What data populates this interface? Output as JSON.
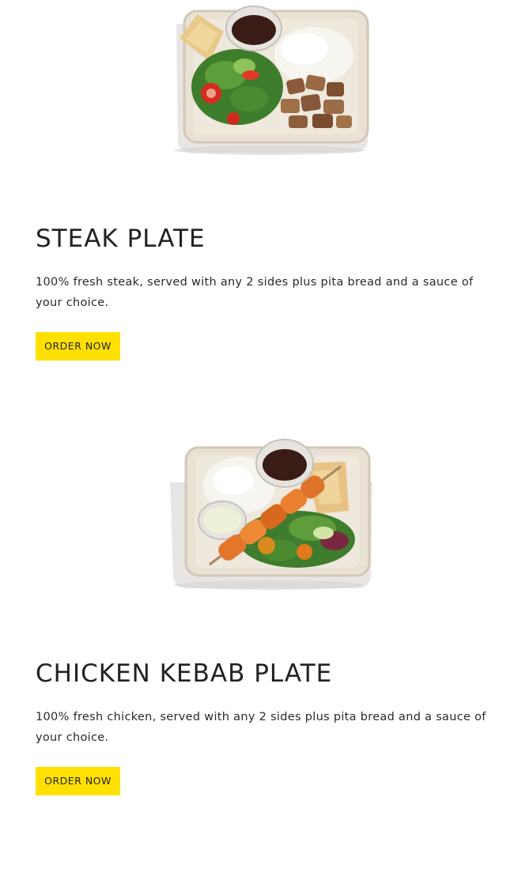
{
  "menu_items": [
    {
      "title": "STEAK PLATE",
      "description": "100% fresh steak, served with any 2 sides plus pita bread and a sauce of your choice.",
      "button_label": "ORDER NOW",
      "image_icon": "steak-plate-image"
    },
    {
      "title": "CHICKEN KEBAB PLATE",
      "description": "100% fresh chicken, served with any 2 sides plus pita bread and a sauce of your choice.",
      "button_label": "ORDER NOW",
      "image_icon": "chicken-kebab-plate-image"
    }
  ],
  "colors": {
    "button_bg": "#ffe000",
    "title_text": "#222222",
    "background": "#ffffff"
  }
}
